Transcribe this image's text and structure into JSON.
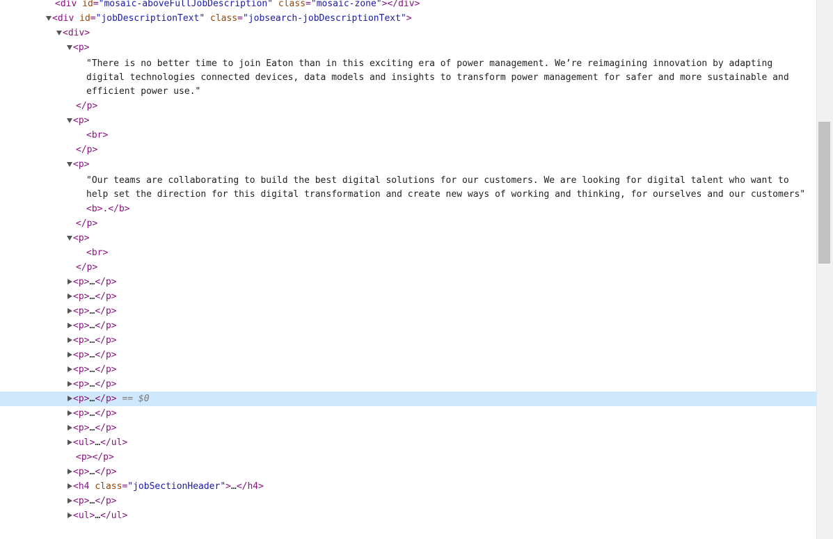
{
  "rows": [
    {
      "open": "<",
      "tag": "div",
      "attrs": [
        {
          "n": "id",
          "v": "\"mosaic-aboveFullJobDescription\""
        },
        {
          "n": "class",
          "v": "\"mosaic-zone\""
        }
      ],
      "close": "></div>"
    },
    {
      "open": "<",
      "tag": "div",
      "attrs": [
        {
          "n": "id",
          "v": "\"jobDescriptionText\""
        },
        {
          "n": "class",
          "v": "\"jobsearch-jobDescriptionText\""
        }
      ],
      "close": ">"
    },
    {
      "open": "<",
      "tag": "div",
      "close": ">"
    },
    {
      "open": "<",
      "tag": "p",
      "close": ">"
    },
    {
      "text": "\"There is no better time to join Eaton than in this exciting era of power management. We’re reimagining innovation by adapting digital technologies connected devices, data models and insights to transform power management for safer and more sustainable and efficient power use.\""
    },
    {
      "end": "</p>"
    },
    {
      "open": "<",
      "tag": "p",
      "close": ">"
    },
    {
      "end": "<br>"
    },
    {
      "end": "</p>"
    },
    {
      "open": "<",
      "tag": "p",
      "close": ">"
    },
    {
      "text": "\"Our teams are collaborating to build the best digital solutions for our customers. We are looking for digital talent who want to help set the direction for this digital transformation and create new ways of working and thinking, for ourselves and our customers\""
    },
    {
      "end": "<b>.</b>"
    },
    {
      "end": "</p>"
    },
    {
      "open": "<",
      "tag": "p",
      "close": ">"
    },
    {
      "end": "<br>"
    },
    {
      "end": "</p>"
    },
    {
      "c": "<p>",
      "ell": "…",
      "e": "</p>"
    },
    {
      "c": "<p>",
      "ell": "…",
      "e": "</p>"
    },
    {
      "c": "<p>",
      "ell": "…",
      "e": "</p>"
    },
    {
      "c": "<p>",
      "ell": "…",
      "e": "</p>"
    },
    {
      "c": "<p>",
      "ell": "…",
      "e": "</p>"
    },
    {
      "c": "<p>",
      "ell": "…",
      "e": "</p>"
    },
    {
      "c": "<p>",
      "ell": "…",
      "e": "</p>"
    },
    {
      "c": "<p>",
      "ell": "…",
      "e": "</p>"
    },
    {
      "c": "<p>",
      "ell": "…",
      "e": "</p>",
      "suffix": " == $0"
    },
    {
      "c": "<p>",
      "ell": "…",
      "e": "</p>"
    },
    {
      "c": "<p>",
      "ell": "…",
      "e": "</p>"
    },
    {
      "c": "<ul>",
      "ell": "…",
      "e": "</ul>"
    },
    {
      "end": "<p></p>"
    },
    {
      "c": "<p>",
      "ell": "…",
      "e": "</p>"
    },
    {
      "c": "<h4 ",
      "cls": "class",
      "clsv": "\"jobSectionHeader\"",
      "c2": ">",
      "ell": "…",
      "e": "</h4>"
    },
    {
      "c": "<p>",
      "ell": "…",
      "e": "</p>"
    },
    {
      "c": "<ul>",
      "ell": "…",
      "e": "</ul>"
    }
  ]
}
